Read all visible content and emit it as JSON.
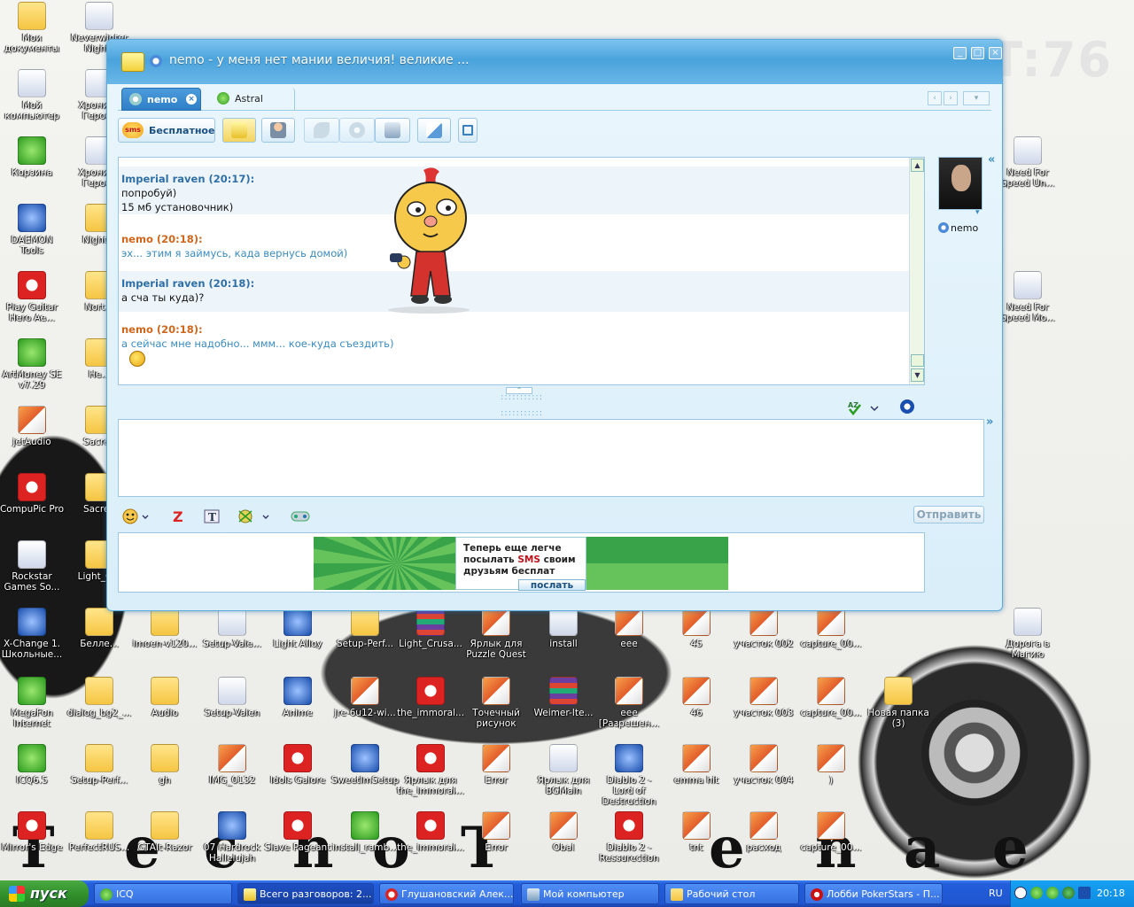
{
  "desktop": {
    "background_text": "HT:76",
    "deco_letters": [
      "T",
      "e",
      "c",
      "h",
      "o",
      "T",
      "e",
      "n",
      "a",
      "e"
    ],
    "icons": [
      {
        "label": "Мои документы",
        "kind": "folder"
      },
      {
        "label": "Neverwinter Nights",
        "kind": "app"
      },
      {
        "label": "Мой компьютер",
        "kind": "app"
      },
      {
        "label": "Хроники Героев",
        "kind": "app"
      },
      {
        "label": "Корзина",
        "kind": "green"
      },
      {
        "label": "Хроники Героев",
        "kind": "app"
      },
      {
        "label": "DAEMON Tools",
        "kind": "blue"
      },
      {
        "label": "Night...",
        "kind": "folder"
      },
      {
        "label": "Play Guitar Hero Ae...",
        "kind": "red"
      },
      {
        "label": "Nort...",
        "kind": "folder"
      },
      {
        "label": "ArtMoney SE v7.29",
        "kind": "green"
      },
      {
        "label": "He...",
        "kind": "folder"
      },
      {
        "label": "jetAudio",
        "kind": "img"
      },
      {
        "label": "Sacred",
        "kind": "folder"
      },
      {
        "label": "CompuPic Pro",
        "kind": "red"
      },
      {
        "label": "Sacred",
        "kind": "folder"
      },
      {
        "label": "Rockstar Games So...",
        "kind": "app"
      },
      {
        "label": "Light_C...",
        "kind": "folder"
      },
      {
        "label": "X-Change 1. Школьные...",
        "kind": "blue"
      },
      {
        "label": "Белле...",
        "kind": "folder"
      },
      {
        "label": "imoen-v120...",
        "kind": "folder"
      },
      {
        "label": "Setup-Vale...",
        "kind": "app"
      },
      {
        "label": "Light Alloy",
        "kind": "blue"
      },
      {
        "label": "Setup-Perf...",
        "kind": "folder"
      },
      {
        "label": "Light_Crusa...",
        "kind": "rar"
      },
      {
        "label": "Ярлык для Puzzle Quest",
        "kind": "img"
      },
      {
        "label": "install",
        "kind": "app"
      },
      {
        "label": "eee",
        "kind": "img"
      },
      {
        "label": "45",
        "kind": "img"
      },
      {
        "label": "участок 002",
        "kind": "img"
      },
      {
        "label": "capture_00...",
        "kind": "img"
      },
      {
        "label": "Дорога в Магию",
        "kind": "app"
      },
      {
        "label": "MegaFon Internet",
        "kind": "green"
      },
      {
        "label": "dialog_bg2_...",
        "kind": "folder"
      },
      {
        "label": "Audio",
        "kind": "folder"
      },
      {
        "label": "Setup-Valen",
        "kind": "app"
      },
      {
        "label": "Anime",
        "kind": "blue"
      },
      {
        "label": "jre-6u12-wi...",
        "kind": "img"
      },
      {
        "label": "the_immoral...",
        "kind": "red"
      },
      {
        "label": "Точечный рисунок",
        "kind": "img"
      },
      {
        "label": "Weimer-Ite...",
        "kind": "rar"
      },
      {
        "label": "eee [Разрешен...",
        "kind": "img"
      },
      {
        "label": "46",
        "kind": "img"
      },
      {
        "label": "участок 003",
        "kind": "img"
      },
      {
        "label": "capture_00...",
        "kind": "img"
      },
      {
        "label": "Новая папка (3)",
        "kind": "folder"
      },
      {
        "label": "ICQ6.5",
        "kind": "green"
      },
      {
        "label": "Setup-Perf...",
        "kind": "folder"
      },
      {
        "label": "gh",
        "kind": "folder"
      },
      {
        "label": "IMG_0132",
        "kind": "img"
      },
      {
        "label": "Idols Galore",
        "kind": "red"
      },
      {
        "label": "SweetImSetup",
        "kind": "blue"
      },
      {
        "label": "Ярлык для the_immoral...",
        "kind": "red"
      },
      {
        "label": "Error",
        "kind": "img"
      },
      {
        "label": "Ярлык для BGMain",
        "kind": "app"
      },
      {
        "label": "Diablo 2 - Lord of Destruction",
        "kind": "blue"
      },
      {
        "label": "emma hit",
        "kind": "img"
      },
      {
        "label": "участок 004",
        "kind": "img"
      },
      {
        "label": ")",
        "kind": "img"
      },
      {
        "label": "Mirror's Edge",
        "kind": "red"
      },
      {
        "label": "PerfectRUS...",
        "kind": "folder"
      },
      {
        "label": "GTAIt-Razor",
        "kind": "folder"
      },
      {
        "label": "07 Hardrock Hallelujah",
        "kind": "blue"
      },
      {
        "label": "Slave Pageant",
        "kind": "red"
      },
      {
        "label": "install_ramb...",
        "kind": "green"
      },
      {
        "label": "the_immoral...",
        "kind": "red"
      },
      {
        "label": "Error",
        "kind": "img"
      },
      {
        "label": "Obal",
        "kind": "img"
      },
      {
        "label": "Diablo 2 - Ressurection",
        "kind": "red"
      },
      {
        "label": "tnt",
        "kind": "img"
      },
      {
        "label": "расход",
        "kind": "img"
      },
      {
        "label": "capture_00...",
        "kind": "img"
      },
      {
        "label": "Need For Speed Un...",
        "kind": "app"
      },
      {
        "label": "Need For Speed Mo...",
        "kind": "app"
      }
    ]
  },
  "window": {
    "title": "nemo - у меня нет мании величия! великие ...",
    "buttons": {
      "minimize": "_",
      "maximize": "□",
      "close": "×"
    },
    "tabs": [
      {
        "label": "nemo",
        "active": true
      },
      {
        "label": "Astral",
        "active": false
      }
    ],
    "toolbar": {
      "sms_badge": "sms",
      "sms_label": "Бесплатное"
    },
    "history": {
      "messages": [
        {
          "author": "Imperial raven (20:17):",
          "role": "raven",
          "lines": [
            "попробуй)",
            "15 мб установочник)"
          ]
        },
        {
          "author": "nemo (20:18):",
          "role": "nemo",
          "lines": [
            "эх... этим я займусь, када вернусь домой)"
          ]
        },
        {
          "author": "Imperial raven (20:18):",
          "role": "raven",
          "lines": [
            "а сча ты куда)?"
          ]
        },
        {
          "author": "nemo (20:18):",
          "role": "nemo",
          "lines": [
            "а сейчас мне надобно... ммм... кое-куда съездить)"
          ]
        }
      ]
    },
    "input": {
      "value": "",
      "placeholder": ""
    },
    "send_label": "Отправить",
    "ad": {
      "line1": "Теперь еще легче",
      "line2_pre": "посылать ",
      "line2_sms": "SMS",
      "line2_post": " своим",
      "line3": "друзьям бесплат",
      "button": "послать"
    },
    "contact": {
      "name": "nemo"
    },
    "colors": {
      "author_raven": "#2f6fa8",
      "author_nemo": "#d0661b",
      "accent": "#4aa3dc"
    }
  },
  "taskbar": {
    "start_label": "пуск",
    "tasks": [
      {
        "label": "ICQ",
        "active": false
      },
      {
        "label": "Всего разговоров: 2...",
        "active": true
      },
      {
        "label": "Глушановский Алек...",
        "active": false
      },
      {
        "label": "Мой компьютер",
        "active": false
      },
      {
        "label": "Рабочий стол",
        "active": false
      },
      {
        "label": "Лобби PokerStars - П...",
        "active": false
      }
    ],
    "lang": "RU",
    "clock": "20:18"
  }
}
